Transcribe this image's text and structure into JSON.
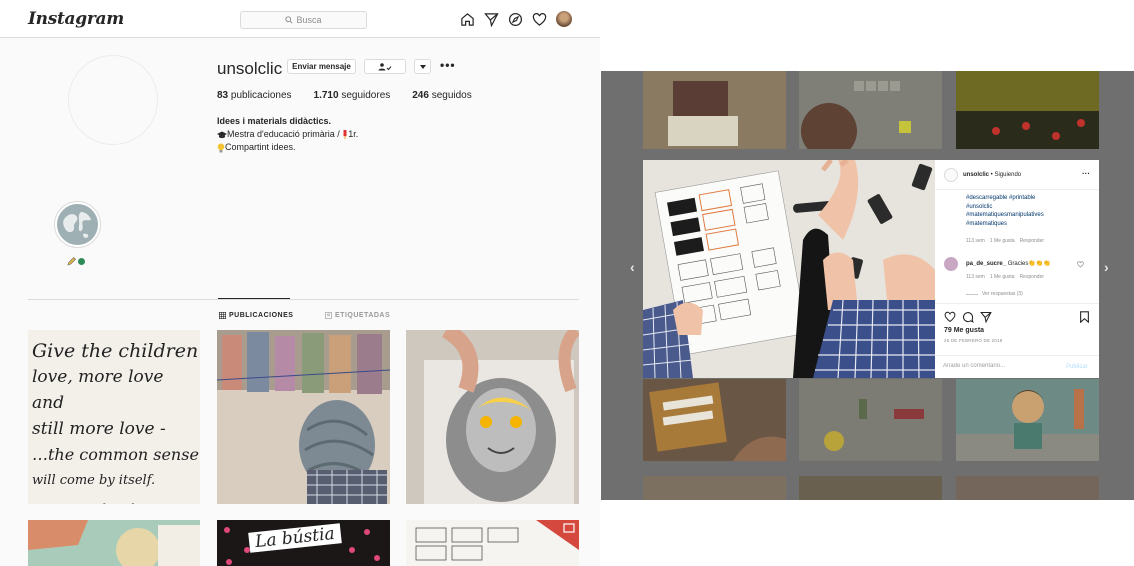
{
  "topnav": {
    "logo": "Instagram",
    "search_placeholder": "Busca"
  },
  "profile": {
    "username": "unsolclic",
    "message_button": "Enviar mensaje",
    "stats": {
      "posts_count": "83",
      "posts_label": "publicaciones",
      "followers_count": "1.710",
      "followers_label": "seguidores",
      "following_count": "246",
      "following_label": "seguidos"
    },
    "bio_name": "Idees i materials didàctics.",
    "bio_line2": "Mestra d'educació primària / ",
    "bio_line2_suffix": "1r.",
    "bio_line3": "Compartint idees."
  },
  "tabs": {
    "posts": "PUBLICACIONES",
    "tagged": "ETIQUETADAS"
  },
  "tiles": {
    "quote_lines": [
      "Give the children",
      "love, more love and",
      "still more love -",
      "…the common sense",
      "will come by itself."
    ],
    "quote_signature": "Astrid Lindgren",
    "tile5_text": "La bústia"
  },
  "post": {
    "header_user": "unsolclic",
    "header_follow": " • Siguiendo",
    "hashtags": [
      "#descarregable #printable",
      "#unsolclic",
      "#matematiquesmanipulatives",
      "#matematiques"
    ],
    "caption_meta": {
      "time": "113 sem",
      "likes": "1 Me gusta",
      "reply": "Responder"
    },
    "comment": {
      "user": "pa_de_sucre_",
      "text": "Gracies👏👏👏"
    },
    "comment_meta": {
      "time": "113 sem",
      "likes": "1 Me gusta",
      "reply": "Responder"
    },
    "view_replies": "Ver respuestas (3)",
    "likes_text": "79 Me gusta",
    "date": "26 DE FEBRERO DE 2018",
    "comment_placeholder": "Añade un comentario...",
    "publish": "Publicar"
  }
}
